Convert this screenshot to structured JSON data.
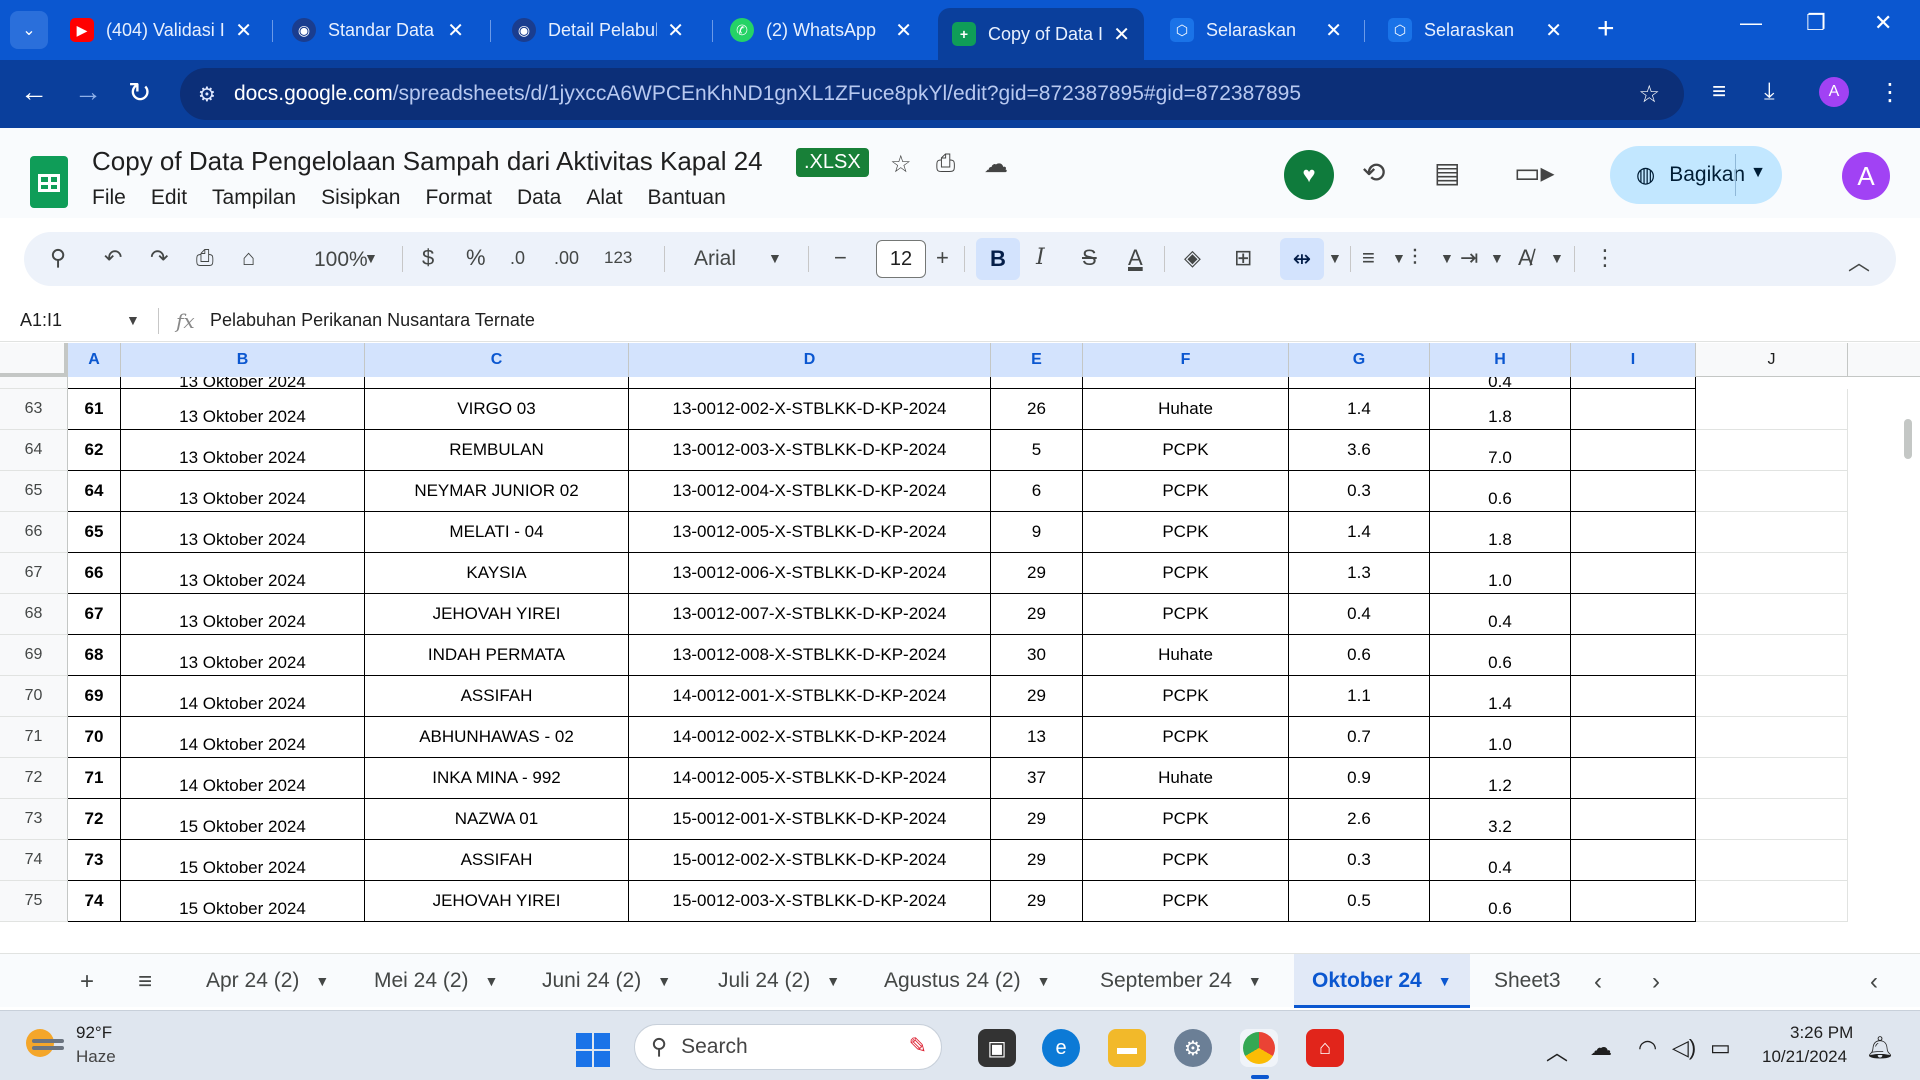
{
  "browser": {
    "tabs": [
      {
        "title": "(404) Validasi I",
        "icon": "youtube-icon",
        "color": "#ff0000"
      },
      {
        "title": "Standar Data F",
        "icon": "emblem-icon",
        "color": "#1a3d8f"
      },
      {
        "title": "Detail Pelabuh",
        "icon": "emblem-icon",
        "color": "#1a3d8f"
      },
      {
        "title": "(2) WhatsApp",
        "icon": "whatsapp-icon",
        "color": "#25d366"
      },
      {
        "title": "Copy of Data I",
        "icon": "sheets-icon",
        "color": "#0f9d58"
      },
      {
        "title": "Selaraskan",
        "icon": "hexagon-icon",
        "color": "#1a73e8"
      },
      {
        "title": "Selaraskan",
        "icon": "hexagon-icon",
        "color": "#1a73e8"
      }
    ],
    "url_host": "docs.google.com",
    "url_path": "/spreadsheets/d/1jyxccA6WPCEnKhND1gnXL1ZFuce8pkYl/edit?gid=872387895#gid=872387895",
    "profile_initial": "A"
  },
  "doc": {
    "title": "Copy of Data Pengelolaan Sampah dari Aktivitas Kapal 24",
    "format_badge": ".XLSX",
    "menu": [
      "File",
      "Edit",
      "Tampilan",
      "Sisipkan",
      "Format",
      "Data",
      "Alat",
      "Bantuan"
    ],
    "share_label": "Bagikan",
    "avatar_initial": "A"
  },
  "toolbar": {
    "zoom": "100%",
    "currency": "$",
    "percent": "%",
    "dec_decrease": ".0",
    "dec_increase": ".00",
    "number_format": "123",
    "font": "Arial",
    "font_size": "12",
    "bold": "B",
    "italic": "I",
    "text_color": "A"
  },
  "formula_bar": {
    "name_box": "A1:I1",
    "formula": "Pelabuhan Perikanan Nusantara Ternate"
  },
  "grid": {
    "columns": [
      "A",
      "B",
      "C",
      "D",
      "E",
      "F",
      "G",
      "H",
      "I",
      "J"
    ],
    "partial_row": {
      "b": "13 Oktober 2024",
      "h": "0.4"
    },
    "rows": [
      {
        "rh": "63",
        "a": "61",
        "b": "13 Oktober 2024",
        "c": "VIRGO 03",
        "d": "13-0012-002-X-STBLKK-D-KP-2024",
        "e": "26",
        "f": "Huhate",
        "g": "1.4",
        "h": "1.8"
      },
      {
        "rh": "64",
        "a": "62",
        "b": "13 Oktober 2024",
        "c": "REMBULAN",
        "d": "13-0012-003-X-STBLKK-D-KP-2024",
        "e": "5",
        "f": "PCPK",
        "g": "3.6",
        "h": "7.0"
      },
      {
        "rh": "65",
        "a": "64",
        "b": "13 Oktober 2024",
        "c": "NEYMAR JUNIOR 02",
        "d": "13-0012-004-X-STBLKK-D-KP-2024",
        "e": "6",
        "f": "PCPK",
        "g": "0.3",
        "h": "0.6"
      },
      {
        "rh": "66",
        "a": "65",
        "b": "13 Oktober 2024",
        "c": "MELATI - 04",
        "d": "13-0012-005-X-STBLKK-D-KP-2024",
        "e": "9",
        "f": "PCPK",
        "g": "1.4",
        "h": "1.8"
      },
      {
        "rh": "67",
        "a": "66",
        "b": "13 Oktober 2024",
        "c": "KAYSIA",
        "d": "13-0012-006-X-STBLKK-D-KP-2024",
        "e": "29",
        "f": "PCPK",
        "g": "1.3",
        "h": "1.0"
      },
      {
        "rh": "68",
        "a": "67",
        "b": "13 Oktober 2024",
        "c": "JEHOVAH YIREI",
        "d": "13-0012-007-X-STBLKK-D-KP-2024",
        "e": "29",
        "f": "PCPK",
        "g": "0.4",
        "h": "0.4"
      },
      {
        "rh": "69",
        "a": "68",
        "b": "13 Oktober 2024",
        "c": "INDAH PERMATA",
        "d": "13-0012-008-X-STBLKK-D-KP-2024",
        "e": "30",
        "f": "Huhate",
        "g": "0.6",
        "h": "0.6"
      },
      {
        "rh": "70",
        "a": "69",
        "b": "14 Oktober 2024",
        "c": "ASSIFAH",
        "d": "14-0012-001-X-STBLKK-D-KP-2024",
        "e": "29",
        "f": "PCPK",
        "g": "1.1",
        "h": "1.4"
      },
      {
        "rh": "71",
        "a": "70",
        "b": "14 Oktober 2024",
        "c": "ABHUNHAWAS - 02",
        "d": "14-0012-002-X-STBLKK-D-KP-2024",
        "e": "13",
        "f": "PCPK",
        "g": "0.7",
        "h": "1.0"
      },
      {
        "rh": "72",
        "a": "71",
        "b": "14 Oktober 2024",
        "c": "INKA MINA - 992",
        "d": "14-0012-005-X-STBLKK-D-KP-2024",
        "e": "37",
        "f": "Huhate",
        "g": "0.9",
        "h": "1.2"
      },
      {
        "rh": "73",
        "a": "72",
        "b": "15 Oktober 2024",
        "c": "NAZWA 01",
        "d": "15-0012-001-X-STBLKK-D-KP-2024",
        "e": "29",
        "f": "PCPK",
        "g": "2.6",
        "h": "3.2"
      },
      {
        "rh": "74",
        "a": "73",
        "b": "15 Oktober 2024",
        "c": "ASSIFAH",
        "d": "15-0012-002-X-STBLKK-D-KP-2024",
        "e": "29",
        "f": "PCPK",
        "g": "0.3",
        "h": "0.4"
      },
      {
        "rh": "75",
        "a": "74",
        "b": "15 Oktober 2024",
        "c": "JEHOVAH YIREI",
        "d": "15-0012-003-X-STBLKK-D-KP-2024",
        "e": "29",
        "f": "PCPK",
        "g": "0.5",
        "h": "0.6"
      }
    ]
  },
  "sheets": {
    "tabs": [
      "Apr 24 (2)",
      "Mei 24 (2)",
      "Juni 24 (2)",
      "Juli 24 (2)",
      "Agustus 24 (2)",
      "September 24",
      "Oktober 24",
      "Sheet3"
    ],
    "active": "Oktober 24"
  },
  "taskbar": {
    "temperature": "92°F",
    "condition": "Haze",
    "search_placeholder": "Search",
    "time": "3:26 PM",
    "date": "10/21/2024"
  }
}
